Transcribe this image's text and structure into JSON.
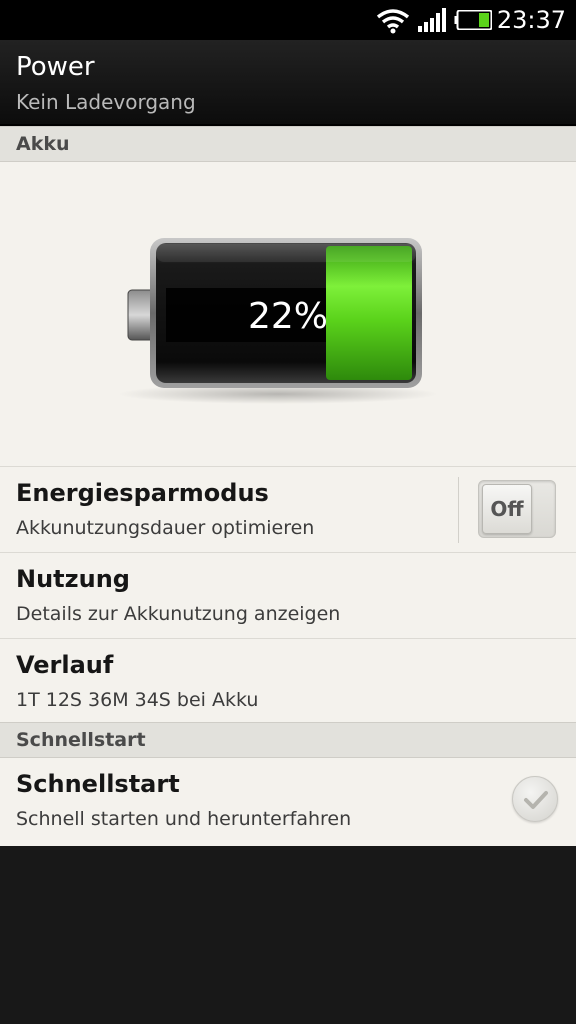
{
  "status_bar": {
    "time": "23:37",
    "icons": [
      "wifi-icon",
      "signal-icon",
      "battery-icon"
    ],
    "battery_level": 0.22
  },
  "header": {
    "title": "Power",
    "subtitle": "Kein Ladevorgang"
  },
  "sections": {
    "akku": {
      "label": "Akku"
    },
    "schnellstart": {
      "label": "Schnellstart"
    }
  },
  "battery": {
    "percent_label": "22%",
    "level": 0.22,
    "colors": {
      "fill": "#5bd31b",
      "body": "#111111"
    }
  },
  "items": {
    "energiesparmodus": {
      "title": "Energiesparmodus",
      "subtitle": "Akkunutzungsdauer optimieren",
      "toggle_label": "Off"
    },
    "nutzung": {
      "title": "Nutzung",
      "subtitle": "Details zur Akkunutzung anzeigen"
    },
    "verlauf": {
      "title": "Verlauf",
      "subtitle": "1T 12S 36M 34S bei Akku"
    },
    "schnellstart": {
      "title": "Schnellstart",
      "subtitle": "Schnell starten und herunterfahren",
      "checked": false
    }
  },
  "colors": {
    "content_bg": "#f4f2ed",
    "section_bg": "#e2e1dc",
    "header_bg": "#141414",
    "page_bg": "#181818"
  }
}
